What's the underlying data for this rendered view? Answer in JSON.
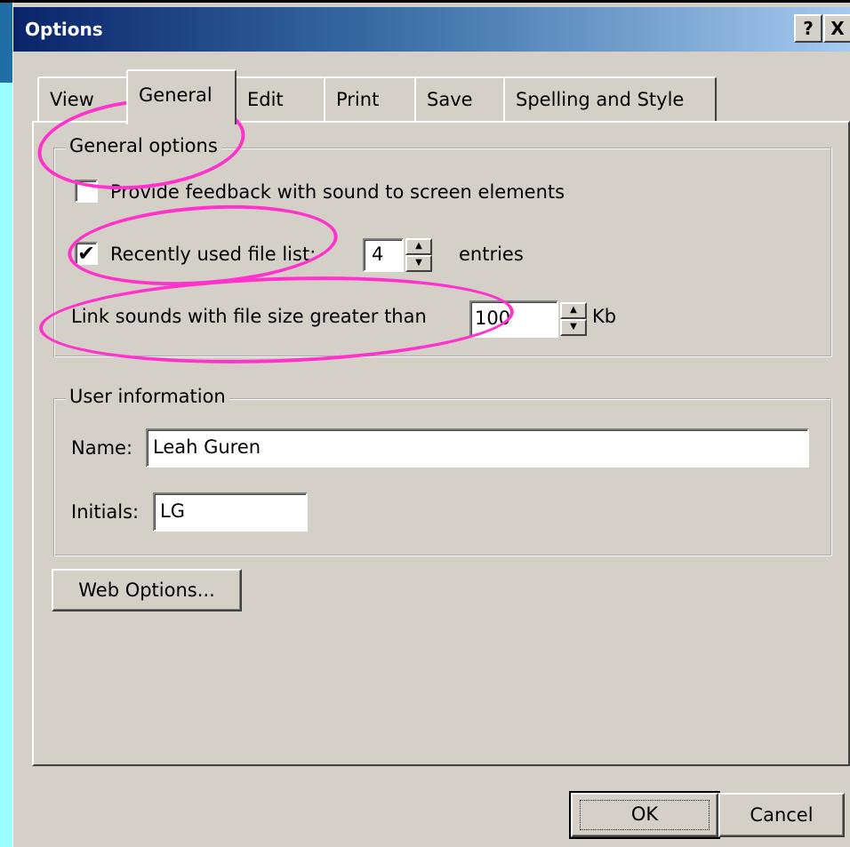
{
  "window": {
    "title": "Options",
    "help_label": "?",
    "close_label": "X"
  },
  "tabs": [
    {
      "label": "View"
    },
    {
      "label": "General"
    },
    {
      "label": "Edit"
    },
    {
      "label": "Print"
    },
    {
      "label": "Save"
    },
    {
      "label": "Spelling and Style"
    }
  ],
  "active_tab": "General",
  "general_options": {
    "title": "General options",
    "feedback": {
      "label": "Provide feedback with sound to screen elements",
      "checked": false
    },
    "recent_files": {
      "label": "Recently used file list:",
      "checked": true,
      "value": "4",
      "suffix": "entries"
    },
    "link_sounds": {
      "label": "Link sounds with file size greater than",
      "value": "100",
      "suffix": "Kb"
    }
  },
  "user_information": {
    "title": "User information",
    "name_label": "Name:",
    "name_value": "Leah Guren",
    "initials_label": "Initials:",
    "initials_value": "LG"
  },
  "buttons": {
    "web_options": "Web Options...",
    "ok": "OK",
    "cancel": "Cancel"
  },
  "colors": {
    "annotation": "#ff33cc",
    "title_bar_start": "#0a246a",
    "background": "#99ffff"
  }
}
